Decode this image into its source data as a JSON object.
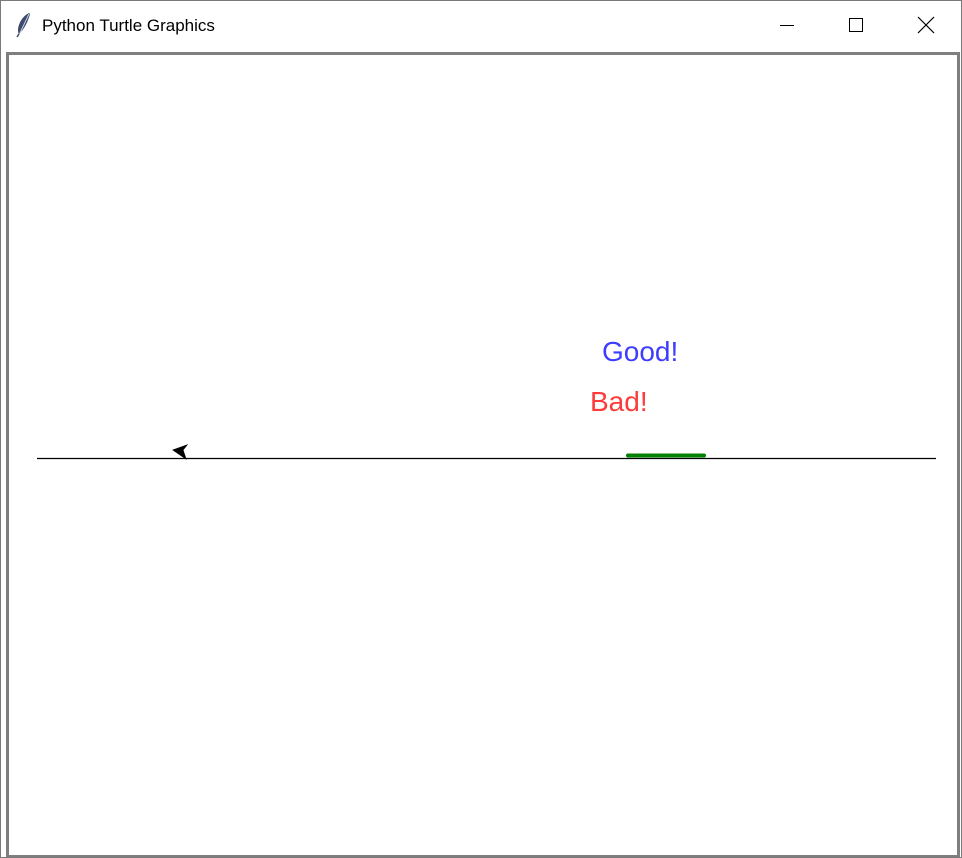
{
  "window": {
    "title": "Python Turtle Graphics",
    "icon": "feather-icon",
    "controls": {
      "minimize_icon": "minimize-icon",
      "maximize_icon": "maximize-icon",
      "close_icon": "close-icon"
    }
  },
  "canvas": {
    "background": "#ffffff",
    "labels": {
      "good": "Good!",
      "bad": "Bad!"
    },
    "colors": {
      "good": "#3d3dff",
      "bad": "#ff3a3a",
      "ground_line": "#000000",
      "target_segment": "#008000",
      "turtle": "#000000"
    },
    "turtle_heading": "left"
  }
}
